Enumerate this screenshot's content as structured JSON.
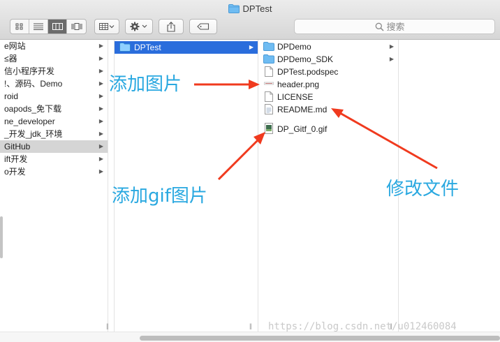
{
  "window": {
    "title": "DPTest"
  },
  "search": {
    "placeholder": "搜索"
  },
  "sidebar": {
    "items": [
      {
        "label": "e网站"
      },
      {
        "label": "≤器"
      },
      {
        "label": "信小程序开发"
      },
      {
        "label": "!、源码、Demo"
      },
      {
        "label": "roid"
      },
      {
        "label": "oapods_免下载"
      },
      {
        "label": "ne_developer"
      },
      {
        "label": "_开发_jdk_环境"
      },
      {
        "label": "GitHub"
      },
      {
        "label": "ift开发"
      },
      {
        "label": "o开发"
      }
    ],
    "selected_index": 8
  },
  "column2": {
    "items": [
      {
        "label": "DPTest"
      }
    ]
  },
  "column3": {
    "items": [
      {
        "label": "DPDemo",
        "kind": "folder"
      },
      {
        "label": "DPDemo_SDK",
        "kind": "folder"
      },
      {
        "label": "DPTest.podspec",
        "kind": "file"
      },
      {
        "label": "header.png",
        "kind": "image"
      },
      {
        "label": "LICENSE",
        "kind": "file"
      },
      {
        "label": "README.md",
        "kind": "text"
      },
      {
        "label": "DP_Gitf_0.gif",
        "kind": "gif"
      }
    ]
  },
  "annotations": {
    "add_image": "添加图片",
    "add_gif": "添加gif图片",
    "modify_file": "修改文件",
    "arrow_color": "#f03a1e",
    "text_color": "#29a8e0"
  },
  "watermark": "https://blog.csdn.net/u012460084",
  "colors": {
    "selection": "#2a6ddc",
    "folder": "#5fb4f0"
  }
}
